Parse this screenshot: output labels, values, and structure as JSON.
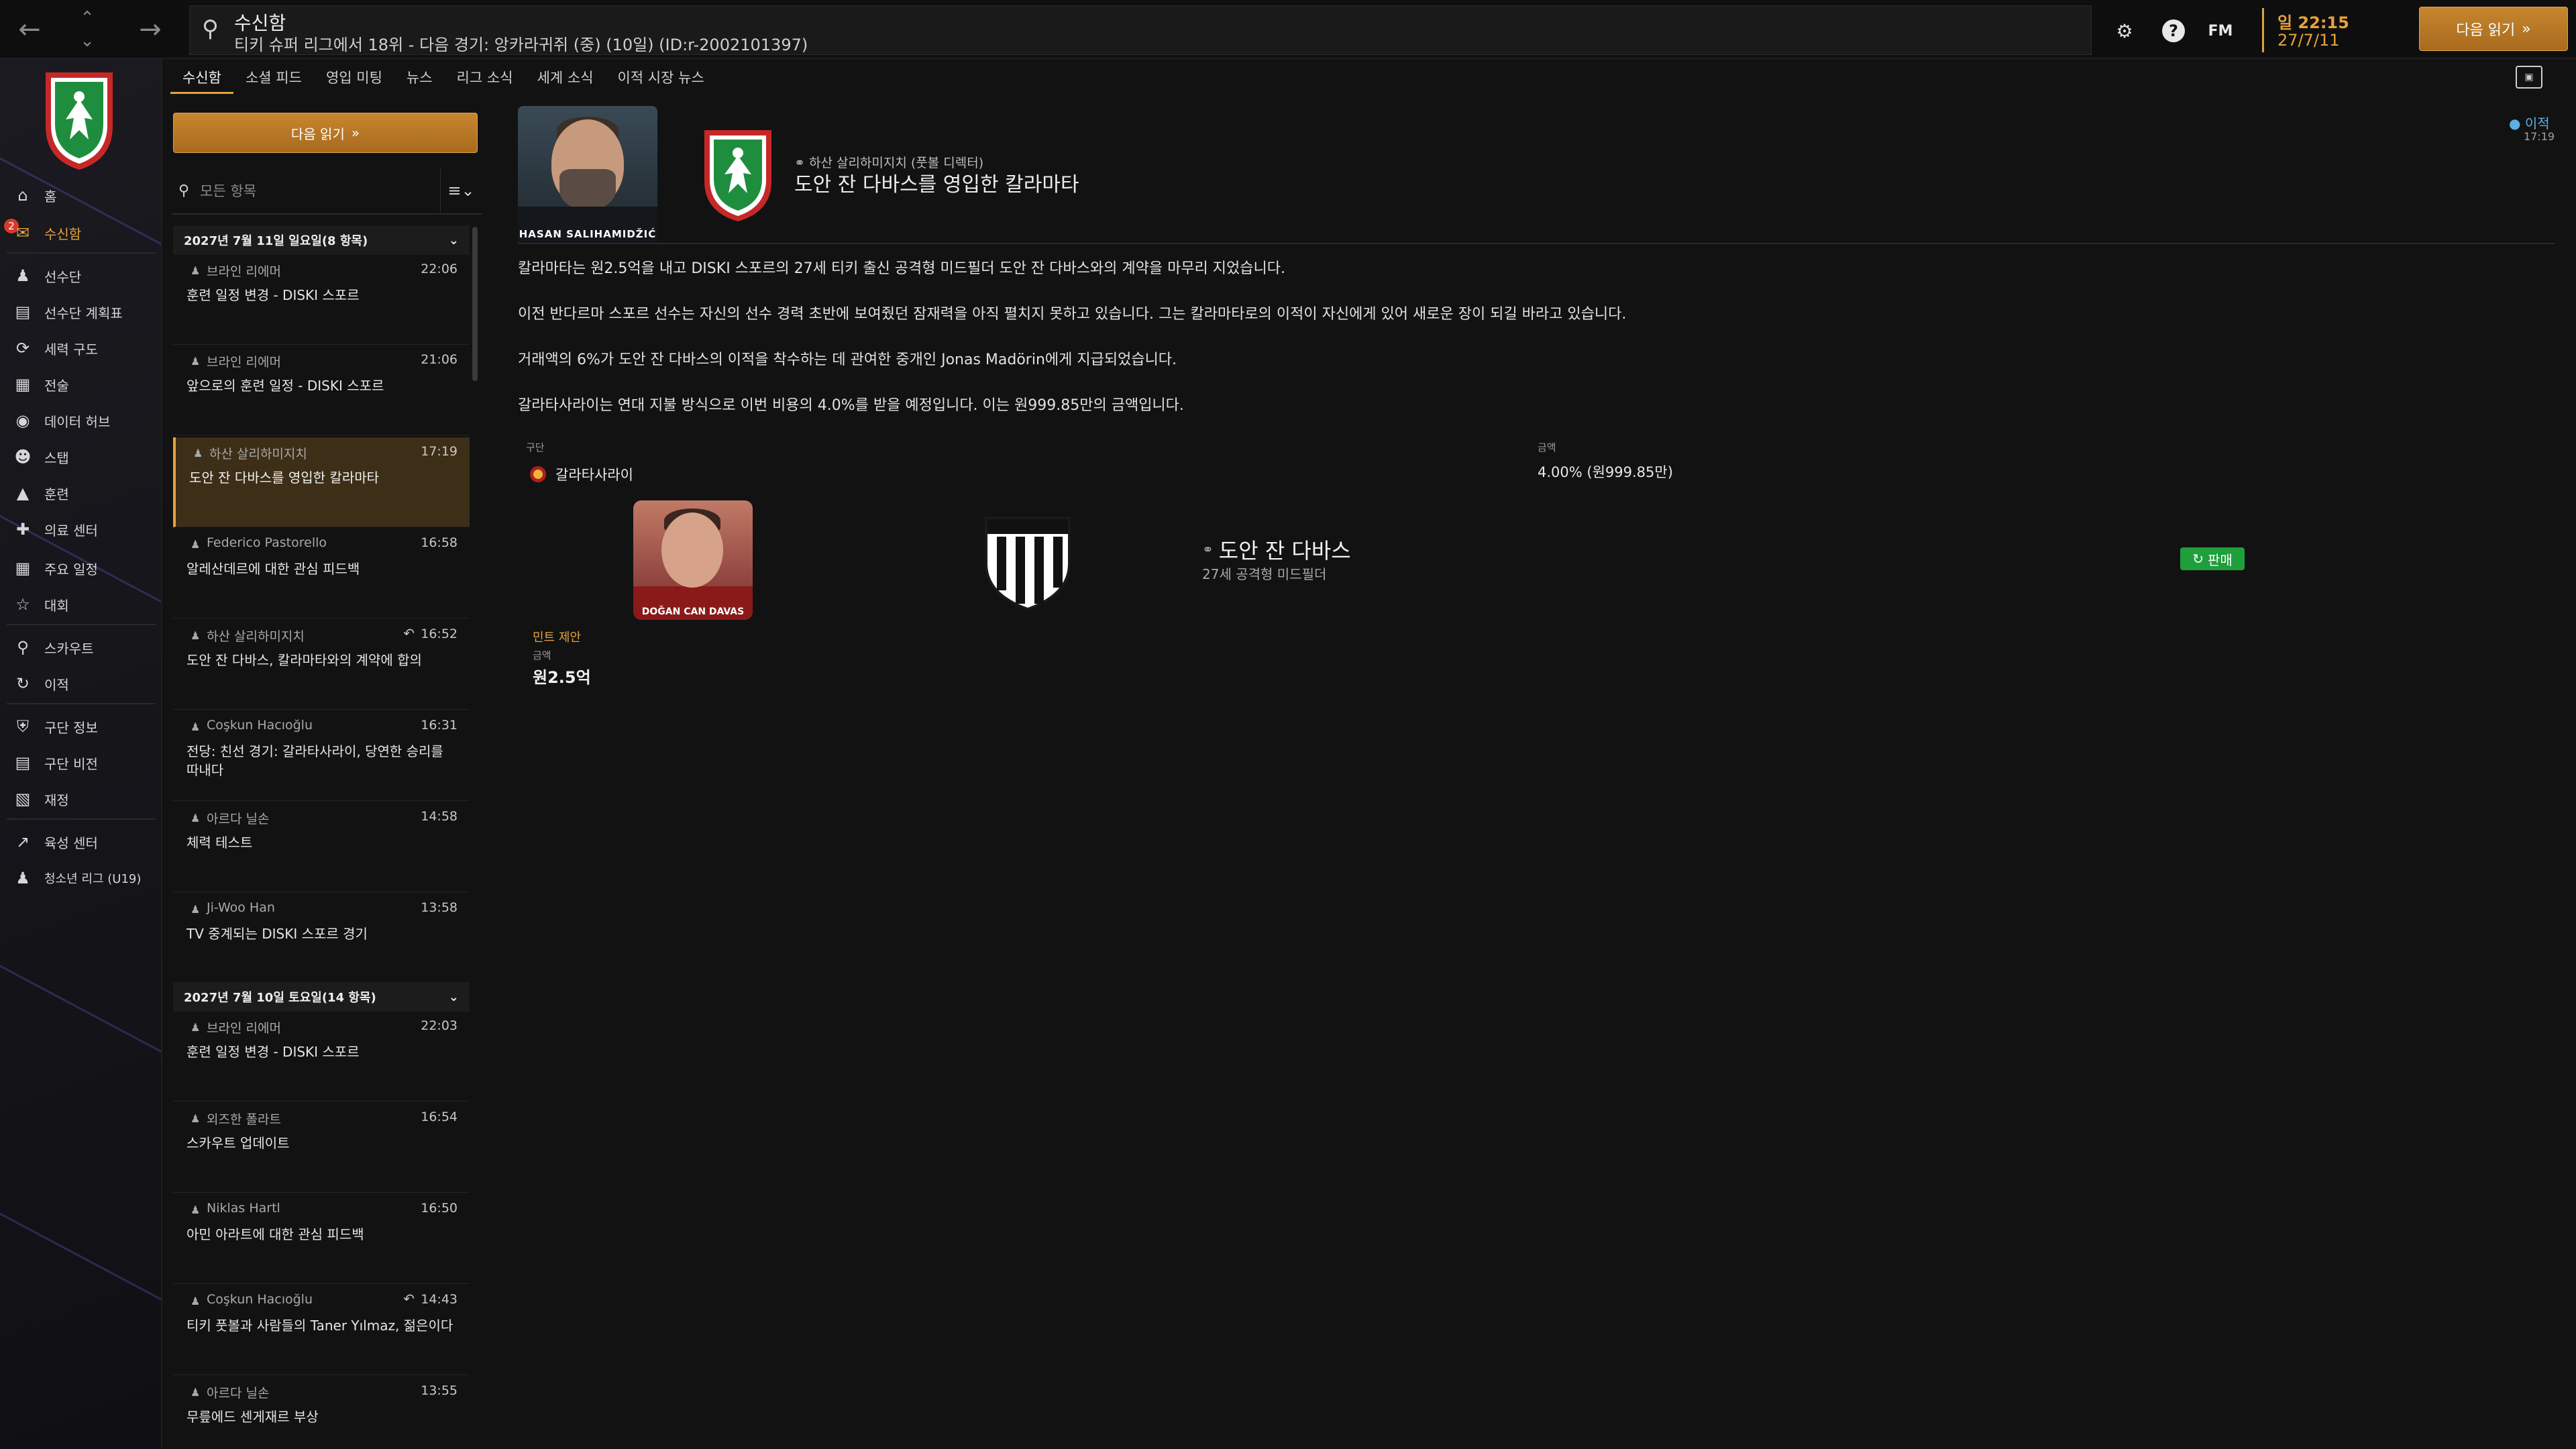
{
  "topbar": {
    "title": "수신함",
    "subtitle": "티키 슈퍼 리그에서 18위 - 다음 경기: 앙카라귀쥐 (중) (10일) (ID:r-2002101397)",
    "fm_label": "FM",
    "time": "일 22:15",
    "date": "27/7/11",
    "continue_label": "다음 읽기"
  },
  "nav": {
    "badge": "2",
    "items": [
      {
        "label": "홈",
        "icon": "home-icon"
      },
      {
        "label": "수신함",
        "icon": "inbox-icon"
      },
      {
        "label": "선수단",
        "icon": "squad-icon"
      },
      {
        "label": "선수단 계획표",
        "icon": "squad-planner-icon"
      },
      {
        "label": "세력 구도",
        "icon": "dynamics-icon"
      },
      {
        "label": "전술",
        "icon": "tactics-icon"
      },
      {
        "label": "데이터 허브",
        "icon": "data-hub-icon"
      },
      {
        "label": "스탭",
        "icon": "staff-icon"
      },
      {
        "label": "훈련",
        "icon": "training-icon"
      },
      {
        "label": "의료 센터",
        "icon": "medical-icon"
      },
      {
        "label": "주요 일정",
        "icon": "schedule-icon"
      },
      {
        "label": "대회",
        "icon": "competitions-icon"
      },
      {
        "label": "스카우트",
        "icon": "scouting-icon"
      },
      {
        "label": "이적",
        "icon": "transfers-icon"
      },
      {
        "label": "구단 정보",
        "icon": "club-info-icon"
      },
      {
        "label": "구단 비전",
        "icon": "club-vision-icon"
      },
      {
        "label": "재정",
        "icon": "finances-icon"
      },
      {
        "label": "육성 센터",
        "icon": "development-icon"
      },
      {
        "label": "청소년 리그 (U19)",
        "icon": "youth-league-icon"
      }
    ]
  },
  "inbox": {
    "tabs": [
      "수신함",
      "소셜 피드",
      "영입 미팅",
      "뉴스",
      "리그 소식",
      "세계 소식",
      "이적 시장 뉴스"
    ],
    "continue_label": "다음 읽기",
    "filter_placeholder": "모든 항목",
    "groups": [
      {
        "header": "2027년 7월 11일 일요일(8 항목)",
        "messages": [
          {
            "sender": "브라인 리에머",
            "time": "22:06",
            "subject": "훈련 일정 변경 - DISKI 스포르",
            "reply": false
          },
          {
            "sender": "브라인 리에머",
            "time": "21:06",
            "subject": "앞으로의 훈련 일정 - DISKI 스포르",
            "reply": false
          },
          {
            "sender": "하산 살리하미지치",
            "time": "17:19",
            "subject": "도안 잔 다바스를 영입한 칼라마타",
            "reply": false,
            "selected": true
          },
          {
            "sender": "Federico Pastorello",
            "time": "16:58",
            "subject": "알레산데르에 대한 관심 피드백",
            "reply": false
          },
          {
            "sender": "하산 살리하미지치",
            "time": "16:52",
            "subject": "도안 잔 다바스, 칼라마타와의 계약에 합의",
            "reply": true
          },
          {
            "sender": "Coşkun Hacıoğlu",
            "time": "16:31",
            "subject": "전당: 친선 경기: 갈라타사라이, 당연한 승리를 따내다",
            "reply": false
          },
          {
            "sender": "아르다 닐손",
            "time": "14:58",
            "subject": "체력 테스트",
            "reply": false
          },
          {
            "sender": "Ji-Woo Han",
            "time": "13:58",
            "subject": "TV 중계되는 DISKI 스포르 경기",
            "reply": false
          }
        ]
      },
      {
        "header": "2027년 7월 10일 토요일(14 항목)",
        "messages": [
          {
            "sender": "브라인 리에머",
            "time": "22:03",
            "subject": "훈련 일정 변경 - DISKI 스포르",
            "reply": false
          },
          {
            "sender": "외즈한 폴라트",
            "time": "16:54",
            "subject": "스카우트 업데이트",
            "reply": false
          },
          {
            "sender": "Niklas Hartl",
            "time": "16:50",
            "subject": "아민 아라트에 대한 관심 피드백",
            "reply": false
          },
          {
            "sender": "Coşkun Hacıoğlu",
            "time": "14:43",
            "subject": "티키 풋볼과 사람들의 Taner Yılmaz, 젊은이다",
            "reply": true
          },
          {
            "sender": "아르다 닐손",
            "time": "13:55",
            "subject": "무릎에드 센게재르 부상",
            "reply": false
          }
        ]
      }
    ]
  },
  "article": {
    "tag": "이적",
    "tag_time": "17:19",
    "photo_caption": "HASAN SALIHAMIDŽIĆ",
    "byline": "하산 살리하미지치 (풋볼 디렉터)",
    "headline": "도안 잔 다바스를 영입한 칼라마타",
    "paragraphs": [
      "칼라마타는 원2.5억을 내고 DISKI 스포르의 27세 티키 출신 공격형 미드필더 도안 잔 다바스와의 계약을 마무리 지었습니다.",
      "이전 반다르마 스포르 선수는 자신의 선수 경력 초반에 보여줬던 잠재력을 아직 펼치지 못하고 있습니다. 그는 칼라마타로의 이적이 자신에게 있어 새로운 장이 되길 바라고 있습니다.",
      "거래액의 6%가 도안 잔 다바스의 이적을 착수하는 데 관여한 중개인 Jonas Madörin에게 지급되었습니다.",
      "갈라타사라이는 연대 지불 방식으로 이번 비용의 4.0%를 받을 예정입니다. 이는 원999.85만의 금액입니다."
    ],
    "solidarity": {
      "club_label": "구단",
      "club": "갈라타사라이",
      "amount_label": "금액",
      "amount": "4.00% (원999.85만)"
    },
    "player": {
      "card_caption": "DOĞAN CAN DAVAS",
      "name": "도안 잔 다바스",
      "desc": "27세 공격형 미드필더",
      "sale_label": "판매",
      "mint_label": "민트 제안",
      "fee_label": "금액",
      "fee": "원2.5억"
    }
  },
  "colors": {
    "accent": "#e8a23a",
    "background": "#121212",
    "selected_bg": "#3d2e17",
    "sale_green": "#1f9e3c",
    "transfer_blue": "#5ab0e6"
  }
}
